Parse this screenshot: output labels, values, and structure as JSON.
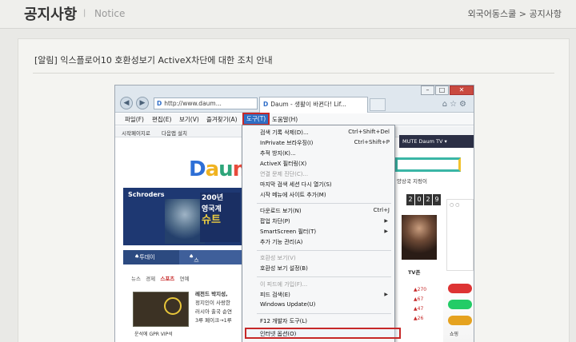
{
  "page": {
    "title": "공지사항",
    "title_en": "Notice",
    "breadcrumb": {
      "parent": "외국어동스쿨",
      "separator": ">",
      "current": "공지사항"
    }
  },
  "post": {
    "title": "[알림] 익스플로어10 호환성보기 ActiveX차단에 대한 조치 안내"
  },
  "screenshot": {
    "address": "http://www.daum...",
    "tab_title": "Daum - 생활이 바뀐다! Lif...",
    "menubar": [
      "파일(F)",
      "편집(E)",
      "보기(V)",
      "즐겨찾기(A)",
      "도구(T)",
      "도움말(H)"
    ],
    "active_menu": "도구(T)",
    "favorites": [
      "시작페이지로",
      "다음앱 설치"
    ],
    "daum_logo": "Daum",
    "nav_right": "MUTE  Daum TV ▾",
    "ad_brand": "Schroders",
    "ad_text": [
      "200년",
      "영국계",
      "슈트"
    ],
    "tabs": {
      "today": "투데이",
      "story": "스토리"
    },
    "subtabs": [
      "뉴스",
      "경제",
      "스포츠",
      "연예"
    ],
    "news": [
      "레전드 박지성,",
      "정지인이 사랑한",
      "러시아 출국 순연",
      "3루 페이크→1루"
    ],
    "caption": "운석에 GPR VIP석",
    "right_header": "양상국 지렁이",
    "clock": [
      "2",
      "0",
      "2",
      "9"
    ],
    "tv_zone": "TV존",
    "stats": [
      "270",
      "67",
      "47",
      "26"
    ],
    "shopping": "쇼핑",
    "tools_menu": [
      {
        "label": "검색 기록 삭제(D)...",
        "shortcut": "Ctrl+Shift+Del"
      },
      {
        "label": "InPrivate 브라우징(I)",
        "shortcut": "Ctrl+Shift+P"
      },
      {
        "label": "추적 방지(K)..."
      },
      {
        "label": "ActiveX 필터링(X)"
      },
      {
        "label": "연결 문제 진단(C)...",
        "disabled": true
      },
      {
        "label": "마지막 검색 세션 다시 열기(S)"
      },
      {
        "label": "시작 메뉴에 사이트 추가(M)"
      },
      {
        "label": "다운로드 보기(N)",
        "shortcut": "Ctrl+J"
      },
      {
        "label": "팝업 차단(P)",
        "submenu": true
      },
      {
        "label": "SmartScreen 필터(T)",
        "submenu": true
      },
      {
        "label": "추가 기능 관리(A)"
      },
      {
        "label": "호환성 보기(V)",
        "disabled": true
      },
      {
        "label": "호환성 보기 설정(B)"
      },
      {
        "label": "이 피드에 가입(F)...",
        "disabled": true
      },
      {
        "label": "피드 검색(E)",
        "submenu": true
      },
      {
        "label": "Windows Update(U)"
      },
      {
        "label": "F12 개발자 도구(L)"
      },
      {
        "label": "인터넷 옵션(O)"
      }
    ]
  }
}
